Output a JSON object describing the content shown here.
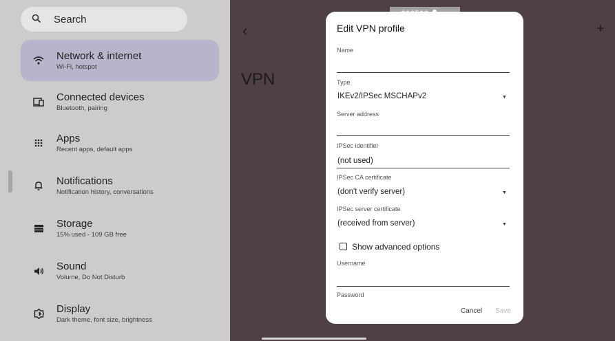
{
  "search": {
    "label": "Search"
  },
  "sidebar": {
    "items": [
      {
        "title": "Network & internet",
        "subtitle": "Wi-Fi, hotspot",
        "icon": "wifi-icon"
      },
      {
        "title": "Connected devices",
        "subtitle": "Bluetooth, pairing",
        "icon": "devices-icon"
      },
      {
        "title": "Apps",
        "subtitle": "Recent apps, default apps",
        "icon": "apps-grid-icon"
      },
      {
        "title": "Notifications",
        "subtitle": "Notification history, conversations",
        "icon": "bell-icon"
      },
      {
        "title": "Storage",
        "subtitle": "15% used - 109 GB free",
        "icon": "storage-icon"
      },
      {
        "title": "Sound",
        "subtitle": "Volume, Do Not Disturb",
        "icon": "speaker-icon"
      },
      {
        "title": "Display",
        "subtitle": "Dark theme, font size, brightness",
        "icon": "brightness-icon"
      }
    ]
  },
  "vpn": {
    "title": "VPN"
  },
  "statusbar": {
    "number": "606566"
  },
  "dialog": {
    "title": "Edit VPN profile",
    "name_label": "Name",
    "name_value": "",
    "type_label": "Type",
    "type_value": "IKEv2/IPSec MSCHAPv2",
    "server_label": "Server address",
    "server_value": "",
    "ipsec_id_label": "IPSec identifier",
    "ipsec_id_value": "(not used)",
    "ca_cert_label": "IPSec CA certificate",
    "ca_cert_value": "(don't verify server)",
    "server_cert_label": "IPSec server certificate",
    "server_cert_value": "(received from server)",
    "advanced_label": "Show advanced options",
    "advanced_checked": false,
    "username_label": "Username",
    "username_value": "",
    "password_label": "Password",
    "cancel_label": "Cancel",
    "save_label": "Save"
  },
  "colors": {
    "active_item_bg": "#b7b4cb",
    "scrim_bg": "#4e4044",
    "dialog_bg": "#ffffff",
    "save_disabled": "#b7b7b7"
  }
}
